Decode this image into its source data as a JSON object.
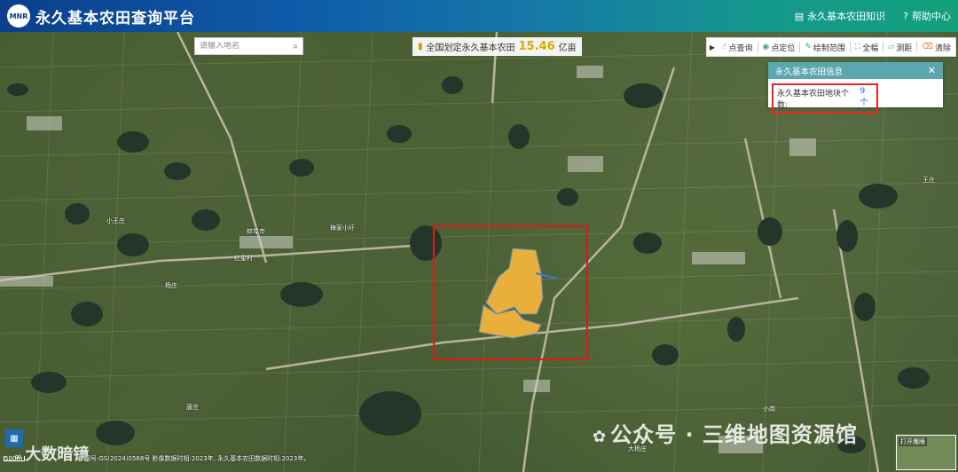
{
  "header": {
    "logo_text": "MNR",
    "title": "永久基本农田查询平台",
    "links": [
      {
        "icon": "book-icon",
        "label": "永久基本农田知识"
      },
      {
        "icon": "help-icon",
        "label": "帮助中心"
      }
    ]
  },
  "search": {
    "placeholder": "请输入地名"
  },
  "stat": {
    "label": "全国划定永久基本农田",
    "value": "15.46",
    "unit": "亿亩"
  },
  "toolbar": {
    "items": [
      {
        "icon": "pointer-icon",
        "label": "点查询"
      },
      {
        "icon": "location-icon",
        "label": "点定位"
      },
      {
        "icon": "draw-icon",
        "label": "绘制范围"
      },
      {
        "icon": "fullscreen-icon",
        "label": "全幅"
      },
      {
        "icon": "ruler-icon",
        "label": "测距"
      },
      {
        "icon": "clear-icon",
        "label": "清除"
      }
    ]
  },
  "info_panel": {
    "title": "永久基本农田信息",
    "count_label": "永久基本农田地块个数:",
    "count_value": "9个"
  },
  "map_labels": {
    "place1": "小王庄",
    "place2": "梅家小圩",
    "place3": "蚌埠市",
    "place4": "红星村",
    "place5": "杨庄",
    "place6": "唐庄",
    "place7": "小岗",
    "place8": "大杨庄",
    "place9": "王庄"
  },
  "footer": {
    "scale": "500m",
    "copyright": "审图号:GS(2024)0568号 影像数据时相:2023年, 永久基本农田数据时相:2023年。",
    "watermark_left": "大数暗镜",
    "watermark_right": "公众号 · 三维地图资源馆",
    "overview_label": "打开鹰眼"
  }
}
